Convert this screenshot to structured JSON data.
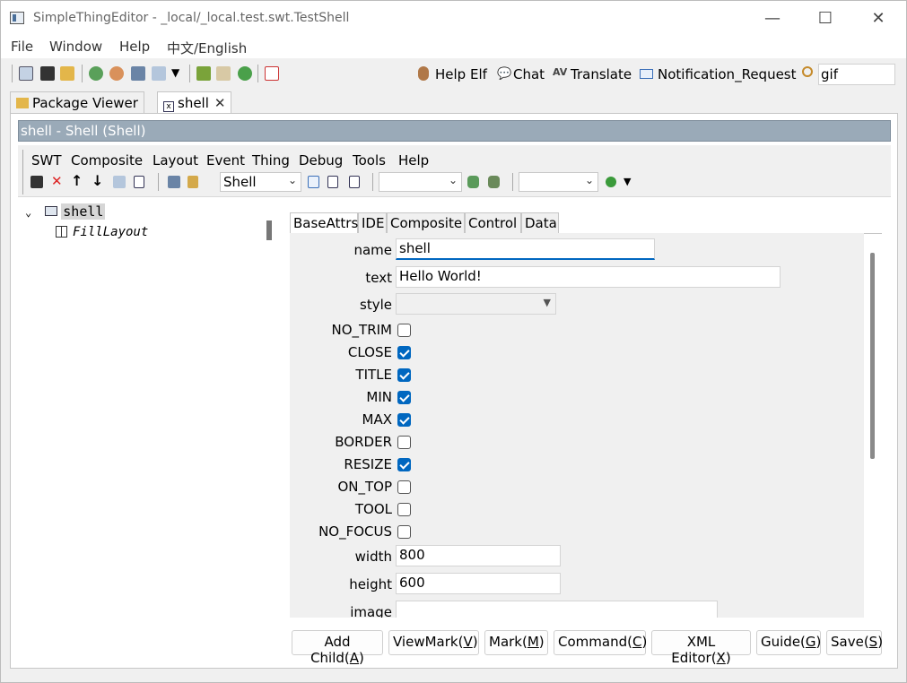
{
  "window": {
    "title": "SimpleThingEditor - _local/_local.test.swt.TestShell",
    "minimize": "—",
    "maximize": "☐",
    "close": "✕"
  },
  "menubar": [
    "File",
    "Window",
    "Help",
    "中文/English"
  ],
  "toolbar": {
    "links": [
      {
        "label": "Help Elf",
        "icon": "person-icon"
      },
      {
        "label": "Chat",
        "icon": "chat-icon"
      },
      {
        "label": "Translate",
        "icon": "translate-icon"
      },
      {
        "label": "Notification_Request",
        "icon": "mail-icon"
      }
    ],
    "search_value": "gif"
  },
  "tabs": [
    {
      "label": "Package Viewer"
    },
    {
      "label": "shell",
      "close": "✕"
    }
  ],
  "shell_header": "shell - Shell  (Shell)",
  "shell_menu": [
    "SWT",
    "Composite",
    "Layout",
    "Event",
    "Thing",
    "Debug",
    "Tools",
    "Help"
  ],
  "shell_toolbar": {
    "combo1": "Shell",
    "combo2": "",
    "combo3": ""
  },
  "tree": {
    "root": "shell",
    "child": "FillLayout"
  },
  "prop_tabs": [
    "BaseAttrs",
    "IDE",
    "Composite",
    "Control",
    "Data"
  ],
  "fields": {
    "name_label": "name",
    "name_value": "shell",
    "text_label": "text",
    "text_value": "Hello World!",
    "style_label": "style",
    "style_value": "",
    "width_label": "width",
    "width_value": "800",
    "height_label": "height",
    "height_value": "600",
    "image_label": "image",
    "image_value": ""
  },
  "checkboxes": [
    {
      "label": "NO_TRIM",
      "checked": false
    },
    {
      "label": "CLOSE",
      "checked": true
    },
    {
      "label": "TITLE",
      "checked": true
    },
    {
      "label": "MIN",
      "checked": true
    },
    {
      "label": "MAX",
      "checked": true
    },
    {
      "label": "BORDER",
      "checked": false
    },
    {
      "label": "RESIZE",
      "checked": true
    },
    {
      "label": "ON_TOP",
      "checked": false
    },
    {
      "label": "TOOL",
      "checked": false
    },
    {
      "label": "NO_FOCUS",
      "checked": false
    }
  ],
  "buttons": [
    {
      "label": "Add Child(",
      "key": "A",
      "end": ")"
    },
    {
      "label": "ViewMark(",
      "key": "V",
      "end": ")"
    },
    {
      "label": "Mark(",
      "key": "M",
      "end": ")"
    },
    {
      "label": "Command(",
      "key": "C",
      "end": ")"
    },
    {
      "label": "XML Editor(",
      "key": "X",
      "end": ")"
    },
    {
      "label": "Guide(",
      "key": "G",
      "end": ")"
    },
    {
      "label": "Save(",
      "key": "S",
      "end": ")"
    }
  ],
  "colors": {
    "accent": "#0067c0",
    "header_bar": "#9aaab8"
  }
}
